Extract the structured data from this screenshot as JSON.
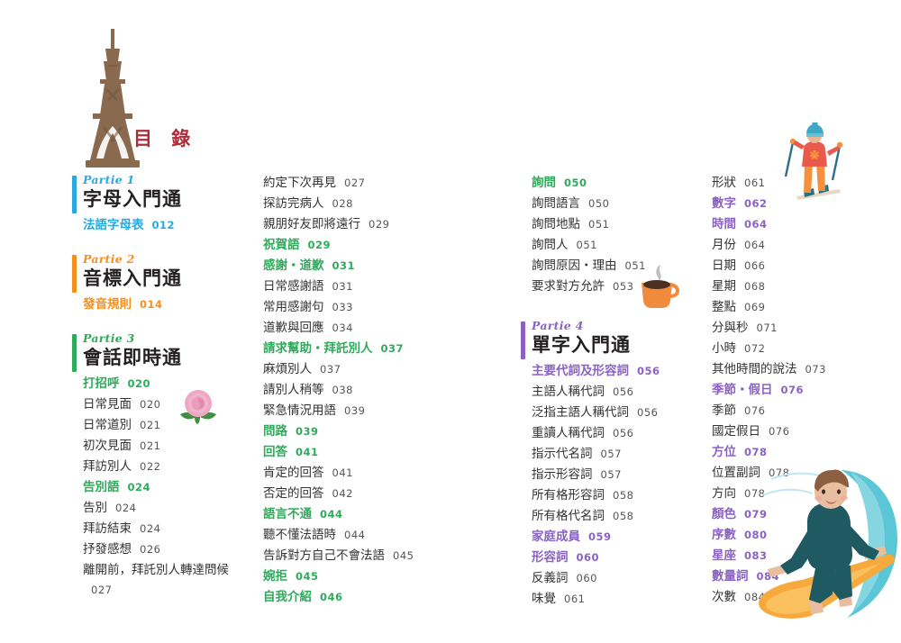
{
  "header": {
    "toc_title": "目 錄",
    "eiffel_icon": "eiffel-tower-icon",
    "title_color": "#b02a38"
  },
  "colors": {
    "partie1": "#29a9e0",
    "partie2": "#f5901e",
    "partie3": "#2eab5a",
    "partie4": "#8b62c4",
    "body_text": "#333333"
  },
  "columns": [
    {
      "id": "col1",
      "blocks": [
        {
          "type": "partie",
          "label": "Partie 1",
          "title": "字母入門通",
          "color": "#29a9e0"
        },
        {
          "type": "entry",
          "head": true,
          "color": "#29a9e0",
          "text": "法語字母表",
          "page": "012"
        },
        {
          "type": "spacer",
          "size": "md"
        },
        {
          "type": "partie",
          "label": "Partie 2",
          "title": "音標入門通",
          "color": "#f5901e"
        },
        {
          "type": "entry",
          "head": true,
          "color": "#f5901e",
          "text": "發音規則",
          "page": "014"
        },
        {
          "type": "spacer",
          "size": "md"
        },
        {
          "type": "partie",
          "label": "Partie 3",
          "title": "會話即時通",
          "color": "#2eab5a"
        },
        {
          "type": "entry",
          "head": true,
          "color": "#2eab5a",
          "text": "打招呼",
          "page": "020"
        },
        {
          "type": "entry",
          "head": false,
          "text": "日常見面",
          "page": "020"
        },
        {
          "type": "entry",
          "head": false,
          "text": "日常道別",
          "page": "021"
        },
        {
          "type": "entry",
          "head": false,
          "text": "初次見面",
          "page": "021"
        },
        {
          "type": "entry",
          "head": false,
          "text": "拜訪別人",
          "page": "022"
        },
        {
          "type": "entry",
          "head": true,
          "color": "#2eab5a",
          "text": "告別語",
          "page": "024"
        },
        {
          "type": "entry",
          "head": false,
          "text": "告別",
          "page": "024"
        },
        {
          "type": "entry",
          "head": false,
          "text": "拜訪結束",
          "page": "024"
        },
        {
          "type": "entry",
          "head": false,
          "text": "抒發感想",
          "page": "026"
        },
        {
          "type": "entry",
          "head": false,
          "wrap": true,
          "text": "離開前，拜託別人轉達問候",
          "page": "027"
        }
      ]
    },
    {
      "id": "col2",
      "blocks": [
        {
          "type": "entry",
          "head": false,
          "text": "約定下次再見",
          "page": "027"
        },
        {
          "type": "entry",
          "head": false,
          "text": "探訪完病人",
          "page": "028"
        },
        {
          "type": "entry",
          "head": false,
          "text": "親朋好友即將遠行",
          "page": "029"
        },
        {
          "type": "entry",
          "head": true,
          "color": "#2eab5a",
          "text": "祝賀語",
          "page": "029"
        },
        {
          "type": "entry",
          "head": true,
          "color": "#2eab5a",
          "text": "感謝・道歉",
          "page": "031"
        },
        {
          "type": "entry",
          "head": false,
          "text": "日常感謝語",
          "page": "031"
        },
        {
          "type": "entry",
          "head": false,
          "text": "常用感謝句",
          "page": "033"
        },
        {
          "type": "entry",
          "head": false,
          "text": "道歉與回應",
          "page": "034"
        },
        {
          "type": "entry",
          "head": true,
          "color": "#2eab5a",
          "text": "請求幫助・拜託別人",
          "page": "037"
        },
        {
          "type": "entry",
          "head": false,
          "text": "麻煩別人",
          "page": "037"
        },
        {
          "type": "entry",
          "head": false,
          "text": "請別人稍等",
          "page": "038"
        },
        {
          "type": "entry",
          "head": false,
          "text": "緊急情況用語",
          "page": "039"
        },
        {
          "type": "entry",
          "head": true,
          "color": "#2eab5a",
          "text": "問路",
          "page": "039"
        },
        {
          "type": "entry",
          "head": true,
          "color": "#2eab5a",
          "text": "回答",
          "page": "041"
        },
        {
          "type": "entry",
          "head": false,
          "text": "肯定的回答",
          "page": "041"
        },
        {
          "type": "entry",
          "head": false,
          "text": "否定的回答",
          "page": "042"
        },
        {
          "type": "entry",
          "head": true,
          "color": "#2eab5a",
          "text": "語言不通",
          "page": "044"
        },
        {
          "type": "entry",
          "head": false,
          "text": "聽不懂法語時",
          "page": "044"
        },
        {
          "type": "entry",
          "head": false,
          "text": "告訴對方自己不會法語",
          "page": "045"
        },
        {
          "type": "entry",
          "head": true,
          "color": "#2eab5a",
          "text": "婉拒",
          "page": "045"
        },
        {
          "type": "entry",
          "head": true,
          "color": "#2eab5a",
          "text": "自我介紹",
          "page": "046"
        }
      ]
    },
    {
      "id": "col3",
      "blocks": [
        {
          "type": "entry",
          "head": true,
          "color": "#2eab5a",
          "text": "詢問",
          "page": "050"
        },
        {
          "type": "entry",
          "head": false,
          "text": "詢問語言",
          "page": "050"
        },
        {
          "type": "entry",
          "head": false,
          "text": "詢問地點",
          "page": "051"
        },
        {
          "type": "entry",
          "head": false,
          "text": "詢問人",
          "page": "051"
        },
        {
          "type": "entry",
          "head": false,
          "text": "詢問原因・理由",
          "page": "051"
        },
        {
          "type": "entry",
          "head": false,
          "text": "要求對方允許",
          "page": "053"
        },
        {
          "type": "spacer",
          "size": "lg"
        },
        {
          "type": "partie",
          "label": "Partie 4",
          "title": "單字入門通",
          "color": "#8b62c4"
        },
        {
          "type": "entry",
          "head": true,
          "color": "#8b62c4",
          "text": "主要代詞及形容詞",
          "page": "056"
        },
        {
          "type": "entry",
          "head": false,
          "text": "主語人稱代詞",
          "page": "056"
        },
        {
          "type": "entry",
          "head": false,
          "text": "泛指主語人稱代詞",
          "page": "056"
        },
        {
          "type": "entry",
          "head": false,
          "text": "重讀人稱代詞",
          "page": "056"
        },
        {
          "type": "entry",
          "head": false,
          "text": "指示代名詞",
          "page": "057"
        },
        {
          "type": "entry",
          "head": false,
          "text": "指示形容詞",
          "page": "057"
        },
        {
          "type": "entry",
          "head": false,
          "text": "所有格形容詞",
          "page": "058"
        },
        {
          "type": "entry",
          "head": false,
          "text": "所有格代名詞",
          "page": "058"
        },
        {
          "type": "entry",
          "head": true,
          "color": "#8b62c4",
          "text": "家庭成員",
          "page": "059"
        },
        {
          "type": "entry",
          "head": true,
          "color": "#8b62c4",
          "text": "形容詞",
          "page": "060"
        },
        {
          "type": "entry",
          "head": false,
          "text": "反義詞",
          "page": "060"
        },
        {
          "type": "entry",
          "head": false,
          "text": "味覺",
          "page": "061"
        }
      ]
    },
    {
      "id": "col4",
      "blocks": [
        {
          "type": "entry",
          "head": false,
          "text": "形狀",
          "page": "061"
        },
        {
          "type": "entry",
          "head": true,
          "color": "#8b62c4",
          "text": "數字",
          "page": "062"
        },
        {
          "type": "entry",
          "head": true,
          "color": "#8b62c4",
          "text": "時間",
          "page": "064"
        },
        {
          "type": "entry",
          "head": false,
          "text": "月份",
          "page": "064"
        },
        {
          "type": "entry",
          "head": false,
          "text": "日期",
          "page": "066"
        },
        {
          "type": "entry",
          "head": false,
          "text": "星期",
          "page": "068"
        },
        {
          "type": "entry",
          "head": false,
          "text": "整點",
          "page": "069"
        },
        {
          "type": "entry",
          "head": false,
          "text": "分與秒",
          "page": "071"
        },
        {
          "type": "entry",
          "head": false,
          "text": "小時",
          "page": "072"
        },
        {
          "type": "entry",
          "head": false,
          "text": "其他時間的說法",
          "page": "073"
        },
        {
          "type": "entry",
          "head": true,
          "color": "#8b62c4",
          "text": "季節・假日",
          "page": "076"
        },
        {
          "type": "entry",
          "head": false,
          "text": "季節",
          "page": "076"
        },
        {
          "type": "entry",
          "head": false,
          "text": "國定假日",
          "page": "076"
        },
        {
          "type": "entry",
          "head": true,
          "color": "#8b62c4",
          "text": "方位",
          "page": "078"
        },
        {
          "type": "entry",
          "head": false,
          "text": "位置副詞",
          "page": "078"
        },
        {
          "type": "entry",
          "head": false,
          "text": "方向",
          "page": "078"
        },
        {
          "type": "entry",
          "head": true,
          "color": "#8b62c4",
          "text": "顏色",
          "page": "079"
        },
        {
          "type": "entry",
          "head": true,
          "color": "#8b62c4",
          "text": "序數",
          "page": "080"
        },
        {
          "type": "entry",
          "head": true,
          "color": "#8b62c4",
          "text": "星座",
          "page": "083"
        },
        {
          "type": "entry",
          "head": true,
          "color": "#8b62c4",
          "text": "數量詞",
          "page": "084"
        },
        {
          "type": "entry",
          "head": false,
          "text": "次數",
          "page": "084"
        }
      ]
    }
  ],
  "art": {
    "rose": "rose-flower-icon",
    "coffee": "coffee-cup-icon",
    "skier": "skier-person-icon",
    "surfer": "surfer-person-icon"
  }
}
